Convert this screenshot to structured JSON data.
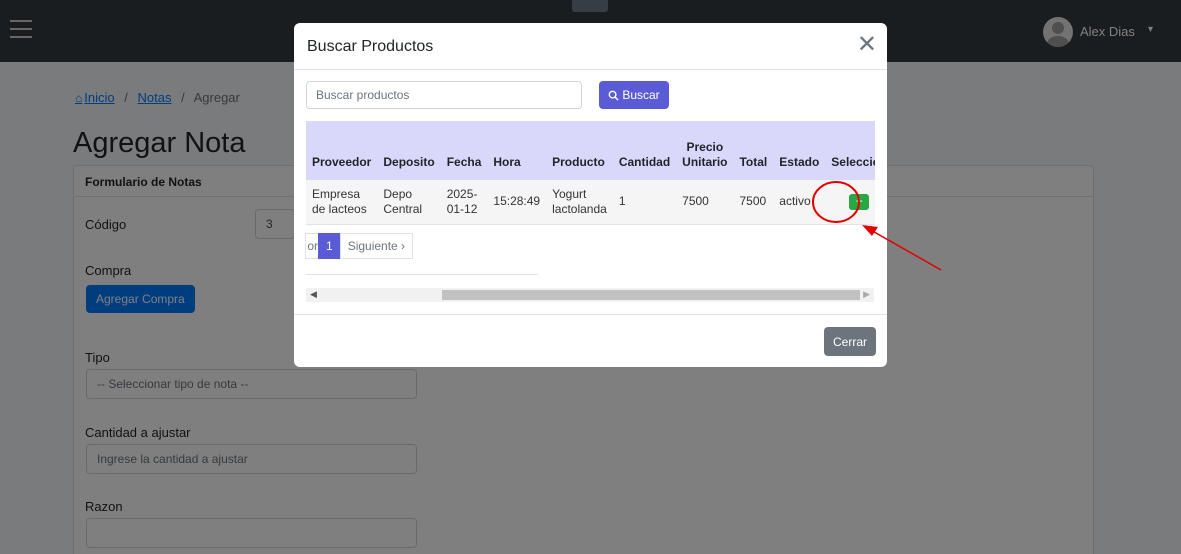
{
  "topbar": {
    "user_name": "Alex Dias"
  },
  "breadcrumb": {
    "home": "Inicio",
    "notes": "Notas",
    "current": "Agregar",
    "sep": "/"
  },
  "page": {
    "title": "Agregar Nota"
  },
  "form": {
    "header": "Formulario de Notas",
    "codigo_label": "Código",
    "codigo_value": "3",
    "compra_label": "Compra",
    "agregar_compra_label": "Agregar Compra",
    "tipo_label": "Tipo",
    "tipo_placeholder": "-- Seleccionar tipo de nota --",
    "cantidad_label": "Cantidad a ajustar",
    "cantidad_placeholder": "Ingrese la cantidad a ajustar",
    "razon_label": "Razon"
  },
  "modal": {
    "title": "Buscar Productos",
    "search_placeholder": "Buscar productos",
    "search_button": "Buscar",
    "columns": [
      "Proveedor",
      "Deposito",
      "Fecha",
      "Hora",
      "Producto",
      "Cantidad",
      "Precio Unitario",
      "Total",
      "Estado",
      "Seleccion"
    ],
    "rows": [
      {
        "proveedor": "Empresa de lacteos",
        "deposito": "Depo Central",
        "fecha": "2025-01-12",
        "hora": "15:28:49",
        "producto": "Yogurt lactolanda",
        "cantidad": "1",
        "precio_unitario": "7500",
        "total": "7500",
        "estado": "activo",
        "seleccion": "+"
      }
    ],
    "pagination": {
      "prev": "or",
      "page": "1",
      "next": "Siguiente ›"
    },
    "close_button": "Cerrar"
  },
  "colors": {
    "topbar": "#343a40",
    "primary": "#007bff",
    "accent": "#5b5bd6",
    "table_header": "#d9d8fb",
    "success": "#28a745",
    "secondary": "#6c757d",
    "annotation": "#e00000"
  }
}
